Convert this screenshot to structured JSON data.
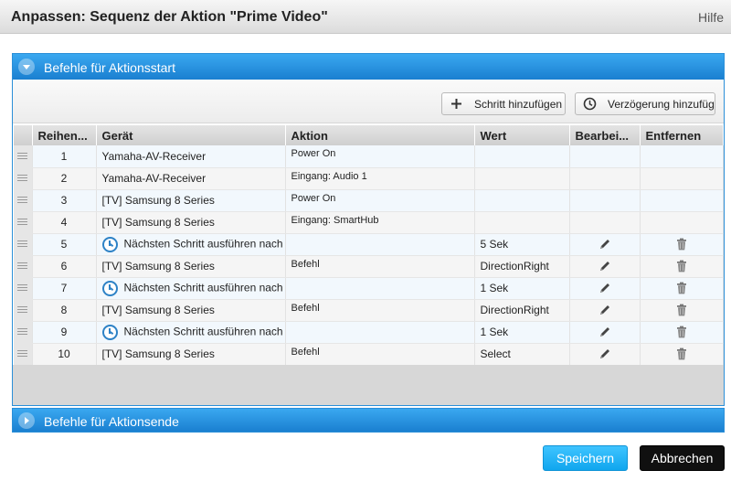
{
  "window": {
    "title": "Anpassen: Sequenz der Aktion \"Prime Video\"",
    "help": "Hilfe"
  },
  "start_panel": {
    "header": "Befehle für Aktionsstart",
    "add_step_label": "Schritt hinzufügen",
    "add_delay_label": "Verzögerung hinzufüg",
    "columns": [
      "Reihen...",
      "Gerät",
      "Aktion",
      "Wert",
      "Bearbei...",
      "Entfernen"
    ],
    "rows": [
      {
        "order": "1",
        "device": "Yamaha-AV-Receiver",
        "action": "Power On",
        "value": "",
        "type": "command",
        "editable": false
      },
      {
        "order": "2",
        "device": "Yamaha-AV-Receiver",
        "action": "Eingang: Audio 1",
        "value": "",
        "type": "command",
        "editable": false
      },
      {
        "order": "3",
        "device": "[TV] Samsung 8 Series",
        "action": "Power On",
        "value": "",
        "type": "command",
        "editable": false
      },
      {
        "order": "4",
        "device": "[TV] Samsung 8 Series",
        "action": "Eingang: SmartHub",
        "value": "",
        "type": "command",
        "editable": false
      },
      {
        "order": "5",
        "device": "Nächsten Schritt ausführen nach",
        "action": "",
        "value": "5 Sek",
        "type": "delay",
        "editable": true
      },
      {
        "order": "6",
        "device": "[TV] Samsung 8 Series",
        "action": "Befehl",
        "value": "DirectionRight",
        "type": "command",
        "editable": true
      },
      {
        "order": "7",
        "device": "Nächsten Schritt ausführen nach",
        "action": "",
        "value": "1 Sek",
        "type": "delay",
        "editable": true
      },
      {
        "order": "8",
        "device": "[TV] Samsung 8 Series",
        "action": "Befehl",
        "value": "DirectionRight",
        "type": "command",
        "editable": true
      },
      {
        "order": "9",
        "device": "Nächsten Schritt ausführen nach",
        "action": "",
        "value": "1 Sek",
        "type": "delay",
        "editable": true
      },
      {
        "order": "10",
        "device": "[TV] Samsung 8 Series",
        "action": "Befehl",
        "value": "Select",
        "type": "command",
        "editable": true
      }
    ]
  },
  "end_panel": {
    "header": "Befehle für Aktionsende"
  },
  "footer": {
    "save_label": "Speichern",
    "cancel_label": "Abbrechen"
  },
  "colors": {
    "accent_blue": "#1a7fd0",
    "save_button": "#10a6ee",
    "cancel_button": "#101010",
    "clock_icon": "#2d82c6"
  }
}
